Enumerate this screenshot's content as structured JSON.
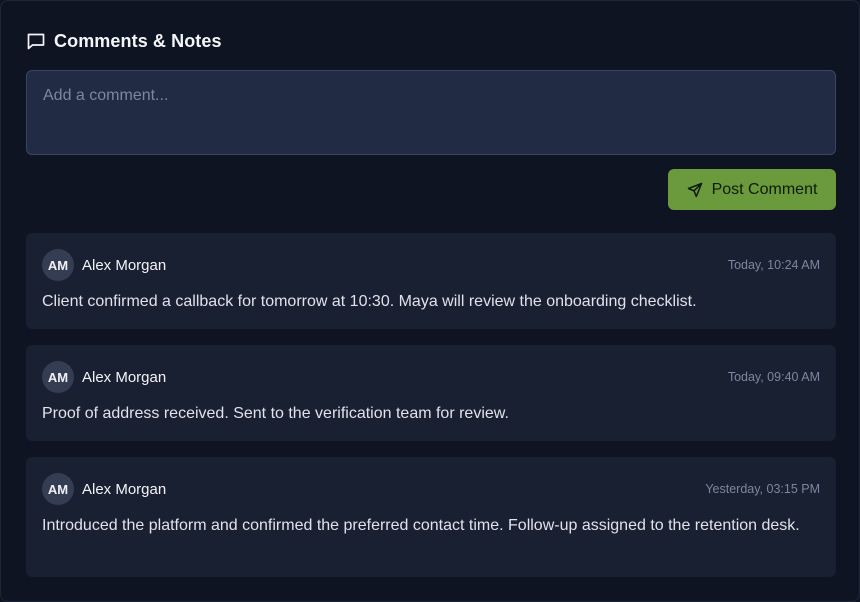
{
  "panel": {
    "title": "Comments & Notes",
    "title_icon": "comment-icon"
  },
  "composer": {
    "placeholder": "Add a comment...",
    "value": "",
    "post_label": "Post Comment",
    "post_icon": "send-icon",
    "accent_color": "#6b9a3c"
  },
  "comments": [
    {
      "initials": "AM",
      "author": "Alex Morgan",
      "timestamp": "Today, 10:24 AM",
      "text": "Client confirmed a callback for tomorrow at 10:30. Maya will review the onboarding checklist."
    },
    {
      "initials": "AM",
      "author": "Alex Morgan",
      "timestamp": "Today, 09:40 AM",
      "text": "Proof of address received. Sent to the verification team for review."
    },
    {
      "initials": "AM",
      "author": "Alex Morgan",
      "timestamp": "Yesterday, 03:15 PM",
      "text": "Introduced the platform and confirmed the preferred contact time. Follow-up assigned to the retention desk."
    }
  ]
}
